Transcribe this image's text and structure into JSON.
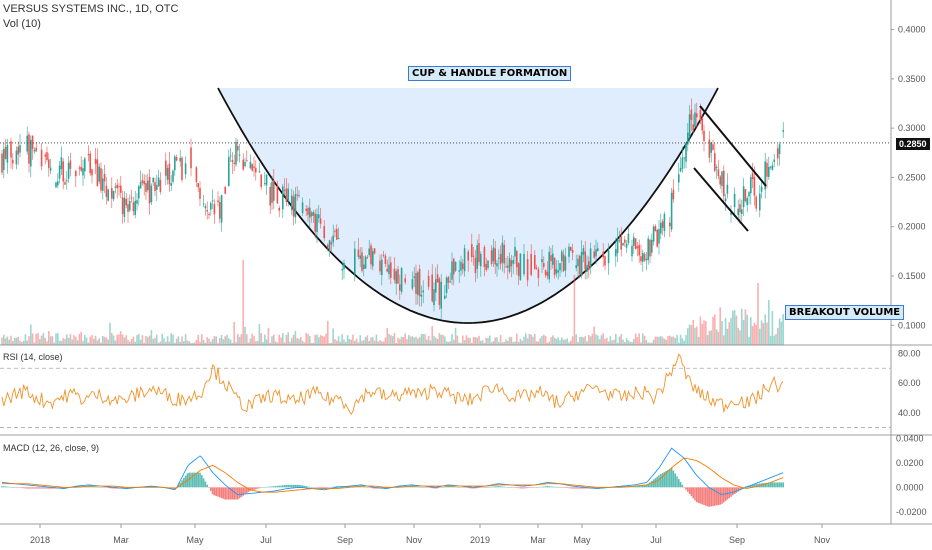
{
  "header": {
    "symbol_line": "VERSUS SYSTEMS INC., 1D, OTC",
    "volume_label": "Vol (10)"
  },
  "annotations": {
    "cup_label": "CUP & HANDLE FORMATION",
    "breakout_label": "BREAKOUT VOLUME"
  },
  "price_tag": "0.2850",
  "rsi_label": "RSI (14, close)",
  "macd_label": "MACD (12, 26, close, 9)",
  "colors": {
    "up": "#26a69a",
    "down": "#ef5350",
    "cup_fill": "#dbeafb",
    "rsi": "#f0932b",
    "macd": "#2196f3",
    "signal": "#f57c00",
    "hist_up": "#26a69a",
    "hist_down": "#ef5350"
  },
  "chart_data": {
    "type": "candlestick",
    "title": "VERSUS SYSTEMS INC., 1D, OTC",
    "x_tick_labels": [
      "2018",
      "Mar",
      "May",
      "Jul",
      "Sep",
      "Nov",
      "2019",
      "Mar",
      "May",
      "Jul",
      "Sep",
      "Nov"
    ],
    "price_axis": {
      "ticks": [
        "0.4000",
        "0.3500",
        "0.3000",
        "0.2500",
        "0.2000",
        "0.1500",
        "0.1000"
      ],
      "ylim": [
        0.08,
        0.43
      ]
    },
    "rsi_axis": {
      "ticks": [
        "80.00",
        "60.00",
        "40.00"
      ],
      "ylim": [
        25,
        85
      ],
      "bands": [
        70,
        30
      ]
    },
    "macd_axis": {
      "ticks": [
        "0.0400",
        "0.0200",
        "0.0000",
        "-0.0200"
      ],
      "ylim": [
        -0.03,
        0.042
      ]
    },
    "current_price": 0.285,
    "price_path": [
      [
        0,
        0.27
      ],
      [
        12,
        0.285
      ],
      [
        24,
        0.26
      ],
      [
        36,
        0.255
      ],
      [
        48,
        0.265
      ],
      [
        58,
        0.24
      ],
      [
        68,
        0.22
      ],
      [
        80,
        0.235
      ],
      [
        90,
        0.25
      ],
      [
        104,
        0.265
      ],
      [
        113,
        0.23
      ],
      [
        120,
        0.215
      ],
      [
        128,
        0.28
      ],
      [
        140,
        0.25
      ],
      [
        152,
        0.23
      ],
      [
        164,
        0.22
      ],
      [
        178,
        0.195
      ],
      [
        192,
        0.165
      ],
      [
        206,
        0.165
      ],
      [
        220,
        0.15
      ],
      [
        232,
        0.14
      ],
      [
        244,
        0.135
      ],
      [
        256,
        0.17
      ],
      [
        268,
        0.165
      ],
      [
        280,
        0.17
      ],
      [
        292,
        0.16
      ],
      [
        304,
        0.16
      ],
      [
        316,
        0.17
      ],
      [
        324,
        0.165
      ],
      [
        334,
        0.165
      ],
      [
        344,
        0.18
      ],
      [
        354,
        0.175
      ],
      [
        362,
        0.185
      ],
      [
        370,
        0.21
      ],
      [
        376,
        0.24
      ],
      [
        382,
        0.3
      ],
      [
        386,
        0.32
      ],
      [
        392,
        0.28
      ],
      [
        398,
        0.26
      ],
      [
        404,
        0.23
      ],
      [
        410,
        0.22
      ],
      [
        416,
        0.24
      ],
      [
        420,
        0.225
      ],
      [
        426,
        0.27
      ],
      [
        432,
        0.285
      ]
    ],
    "rsi_values": [
      48,
      52,
      55,
      50,
      47,
      50,
      53,
      49,
      52,
      51,
      48,
      50,
      54,
      56,
      52,
      49,
      50,
      53,
      70,
      62,
      50,
      44,
      48,
      52,
      50,
      47,
      51,
      53,
      49,
      50,
      43,
      52,
      55,
      50,
      52,
      54,
      51,
      57,
      53,
      50,
      48,
      52,
      58,
      55,
      50,
      51,
      54,
      49,
      46,
      52,
      55,
      57,
      53,
      50,
      52,
      54,
      50,
      62,
      78,
      60,
      52,
      48,
      45,
      50,
      46,
      52,
      60,
      58
    ],
    "macd_values": [
      0.004,
      0.003,
      0.002,
      0.001,
      0.0,
      -0.001,
      0.001,
      0.002,
      0.001,
      0.0,
      -0.001,
      0.0,
      0.001,
      0.0,
      -0.002,
      0.018,
      0.026,
      0.012,
      0.002,
      -0.006,
      -0.005,
      -0.004,
      -0.003,
      -0.001,
      0.0,
      -0.001,
      -0.002,
      0.0,
      0.001,
      0.002,
      0.0,
      -0.001,
      0.001,
      0.002,
      0.001,
      0.0,
      0.002,
      0.001,
      0.0,
      0.001,
      0.003,
      0.002,
      0.001,
      0.002,
      0.004,
      0.003,
      0.001,
      0.0,
      -0.001,
      0.0,
      0.001,
      0.002,
      0.004,
      0.016,
      0.032,
      0.024,
      0.01,
      0.0,
      -0.006,
      -0.004,
      0.0,
      0.004,
      0.008,
      0.012
    ],
    "signal_values": [
      0.003,
      0.003,
      0.003,
      0.002,
      0.001,
      0.0,
      0.0,
      0.001,
      0.001,
      0.001,
      0.0,
      0.0,
      0.0,
      0.0,
      -0.001,
      0.006,
      0.014,
      0.018,
      0.012,
      0.004,
      -0.002,
      -0.004,
      -0.004,
      -0.003,
      -0.002,
      -0.001,
      -0.001,
      -0.001,
      0.0,
      0.001,
      0.001,
      0.0,
      0.0,
      0.001,
      0.001,
      0.001,
      0.001,
      0.001,
      0.001,
      0.001,
      0.002,
      0.002,
      0.002,
      0.002,
      0.003,
      0.003,
      0.002,
      0.001,
      0.0,
      0.0,
      0.0,
      0.001,
      0.002,
      0.006,
      0.016,
      0.024,
      0.022,
      0.016,
      0.008,
      0.002,
      -0.001,
      0.001,
      0.004,
      0.008
    ]
  }
}
